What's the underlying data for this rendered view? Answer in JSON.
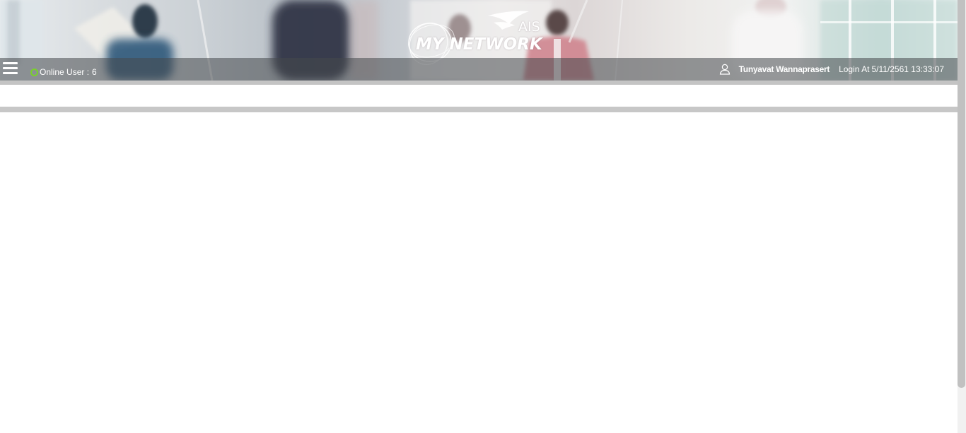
{
  "header": {
    "logo": {
      "brand_small": "AIS",
      "brand_main": "MY NETWORK"
    },
    "menu_icon": "hamburger-menu-icon",
    "online": {
      "label": "Online User :",
      "count": "6",
      "status_color": "#7ad12b"
    },
    "user": {
      "icon": "user-icon",
      "name": "Tunyavat Wannaprasert",
      "login_label": "Login At",
      "login_time": "5/11/2561 13:33:07"
    }
  },
  "colors": {
    "status_bar": "#46484c",
    "separator": "#c4c4c4",
    "scrollbar_thumb": "#c1c1c1"
  }
}
